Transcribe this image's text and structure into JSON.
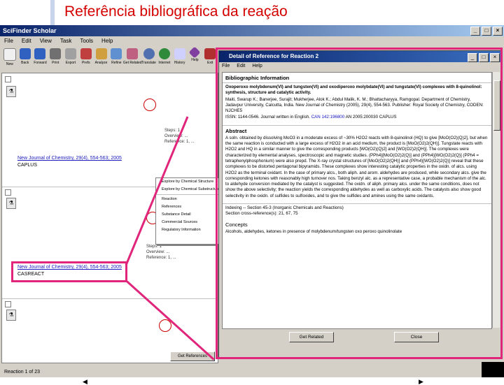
{
  "slide": {
    "title": "Referência bibliográfica da reação"
  },
  "app": {
    "title": "SciFinder Scholar",
    "menus": [
      "File",
      "Edit",
      "View",
      "Task",
      "Tools",
      "Help"
    ],
    "toolbar": [
      "New",
      "Back",
      "Forward",
      "Print",
      "Export",
      "Prefs",
      "Analyze",
      "Refine",
      "Get Related",
      "Translate",
      "Internet",
      "History",
      "Help",
      "Exit"
    ],
    "status": "Reaction 1 of 23",
    "get_reference_label": "Get References"
  },
  "results": [
    {
      "source": "New Journal of Chemistry, 29(4), 554-563; 2005",
      "db": "CAPLUS",
      "lines": [
        "Steps: 1",
        "Overview: ...",
        "Reference: 1, ..."
      ]
    },
    {
      "source": "New Journal of Chemistry, 29(4), 554-563; 2005",
      "db": "CASREACT",
      "lines": [
        "Steps: 1",
        "Overview: ...",
        "Reference: 1, ..."
      ]
    },
    {
      "source": "",
      "db": "",
      "lines": []
    }
  ],
  "context_menu": [
    "Explore by Chemical Structure",
    "Explore by Chemical Substructure",
    "Reaction",
    "References",
    "Substance Detail",
    "Commercial Sources",
    "Regulatory Information"
  ],
  "dialog": {
    "title": "Detail of Reference for Reaction 2",
    "menus": [
      "File",
      "Edit",
      "Help"
    ],
    "bib_heading": "Bibliographic Information",
    "bib_title": "Oxoperoxo molybdenum(VI) and tungsten(VI) and oxodiperoxo molybdate(VI) and tungstate(VI) complexes with 8-quinolinol: synthesis, structure and catalytic activity.",
    "bib_authors": "Maiti, Swarup K.; Banerjee, Surajit; Mukherjee, Alok K.; Abdul Malik, K. M.; Bhattacharyya, Ramgopal.   Department of Chemistry, Jadavpur University, Calcutta, India.   New Journal of Chemistry (2005), 29(4), 554-563. Publisher: Royal Society of Chemistry, CODEN: NJCHE5",
    "bib_issn": "ISSN: 1144-0546. Journal written in English.",
    "bib_can": "CAN 142:196800",
    "bib_an": "AN 2005:200030",
    "bib_db": "CAPLUS",
    "abstract_heading": "Abstract",
    "abstract": "A soln. obtained by dissolving MoO3 in a moderate excess of ~30% H2O2 reacts with 8-quinolinol (HQ) to give [MoO(O2)(Q)2], but when the same reaction is conducted with a large excess of H2O2 in an acid medium, the product is [MoO(O2)2(QH)]. Tungstate reacts with H2O2 and HQ in a similar manner to give the corresponding products [WO(O2)(Q)2] and [WO(O2)2(QH)]. The complexes were characterized by elemental analyses, spectroscopic and magnetic studies. (PPh4)[MoO(O2)2(Q)] and (PPh4)[WO(O2)2(Q)] (PPh4 = tetraphenylphosphonium) were also prepd. The X-ray crystal structures of [MoO(O2)2(QH)] and (PPh4)[WO(O2)2(Q)] reveal that these complexes to be distorted pentagonal bipyramids. These complexes show interesting catalytic properties in the oxidn. of alcs. using H2O2 as the terminal oxidant. In the case of primary alcs., both aliph. and arom. aldehydes are produced, while secondary alcs. give the corresponding ketones with reasonably high turnover nos. Taking benzyl alc. as a representative case, a probable mechanism of the alc. to aldehyde conversion mediated by the catalyst is suggested. The oxidn. of aliph. primary alcs. under the same conditions, does not show the above selectivity; the reaction yields the corresponding aldehydes as well as carboxylic acids. The catalysts also show good selectivity in the oxidn. of sulfides to sulfoxides, and to give the sulfides and amines using the same oxidants.",
    "indexing_heading": "Indexing",
    "indexing": "Indexing -- Section 45-3 (Inorganic Chemicals and Reactions)",
    "crossref": "Section cross-reference(s): 21, 67, 75",
    "concepts_heading": "Concepts",
    "concepts": "Alcohols, aldehydes, ketones in presence of molybdenum/tungsten oxo peroxo quinolinolate",
    "btn_get_related": "Get Related",
    "btn_close": "Close"
  },
  "colors": {
    "highlight": "#e0257a",
    "title_red": "#d40000",
    "link_blue": "#2020c0"
  }
}
